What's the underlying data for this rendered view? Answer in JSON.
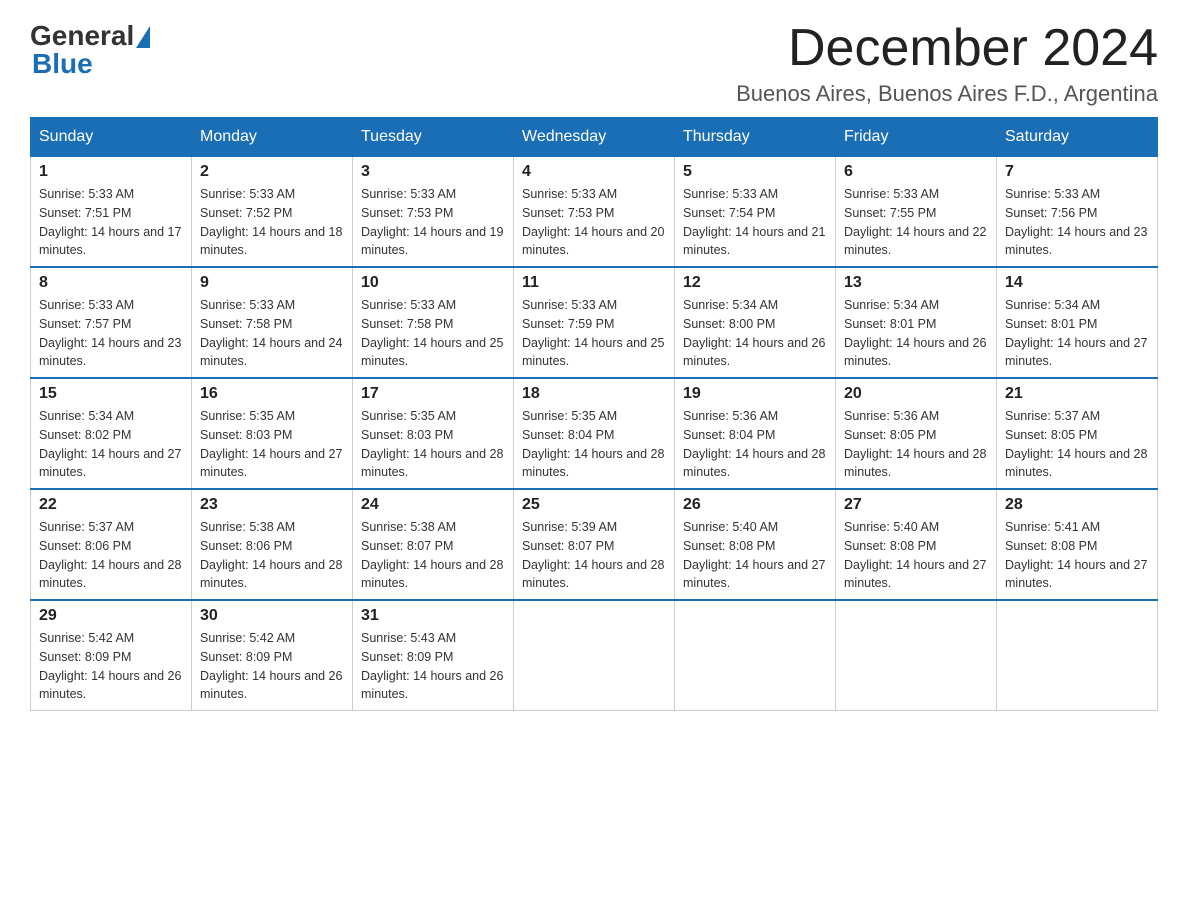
{
  "header": {
    "logo_general": "General",
    "logo_blue": "Blue",
    "month_title": "December 2024",
    "location": "Buenos Aires, Buenos Aires F.D., Argentina"
  },
  "weekdays": [
    "Sunday",
    "Monday",
    "Tuesday",
    "Wednesday",
    "Thursday",
    "Friday",
    "Saturday"
  ],
  "weeks": [
    [
      {
        "day": "1",
        "sunrise": "5:33 AM",
        "sunset": "7:51 PM",
        "daylight": "14 hours and 17 minutes."
      },
      {
        "day": "2",
        "sunrise": "5:33 AM",
        "sunset": "7:52 PM",
        "daylight": "14 hours and 18 minutes."
      },
      {
        "day": "3",
        "sunrise": "5:33 AM",
        "sunset": "7:53 PM",
        "daylight": "14 hours and 19 minutes."
      },
      {
        "day": "4",
        "sunrise": "5:33 AM",
        "sunset": "7:53 PM",
        "daylight": "14 hours and 20 minutes."
      },
      {
        "day": "5",
        "sunrise": "5:33 AM",
        "sunset": "7:54 PM",
        "daylight": "14 hours and 21 minutes."
      },
      {
        "day": "6",
        "sunrise": "5:33 AM",
        "sunset": "7:55 PM",
        "daylight": "14 hours and 22 minutes."
      },
      {
        "day": "7",
        "sunrise": "5:33 AM",
        "sunset": "7:56 PM",
        "daylight": "14 hours and 23 minutes."
      }
    ],
    [
      {
        "day": "8",
        "sunrise": "5:33 AM",
        "sunset": "7:57 PM",
        "daylight": "14 hours and 23 minutes."
      },
      {
        "day": "9",
        "sunrise": "5:33 AM",
        "sunset": "7:58 PM",
        "daylight": "14 hours and 24 minutes."
      },
      {
        "day": "10",
        "sunrise": "5:33 AM",
        "sunset": "7:58 PM",
        "daylight": "14 hours and 25 minutes."
      },
      {
        "day": "11",
        "sunrise": "5:33 AM",
        "sunset": "7:59 PM",
        "daylight": "14 hours and 25 minutes."
      },
      {
        "day": "12",
        "sunrise": "5:34 AM",
        "sunset": "8:00 PM",
        "daylight": "14 hours and 26 minutes."
      },
      {
        "day": "13",
        "sunrise": "5:34 AM",
        "sunset": "8:01 PM",
        "daylight": "14 hours and 26 minutes."
      },
      {
        "day": "14",
        "sunrise": "5:34 AM",
        "sunset": "8:01 PM",
        "daylight": "14 hours and 27 minutes."
      }
    ],
    [
      {
        "day": "15",
        "sunrise": "5:34 AM",
        "sunset": "8:02 PM",
        "daylight": "14 hours and 27 minutes."
      },
      {
        "day": "16",
        "sunrise": "5:35 AM",
        "sunset": "8:03 PM",
        "daylight": "14 hours and 27 minutes."
      },
      {
        "day": "17",
        "sunrise": "5:35 AM",
        "sunset": "8:03 PM",
        "daylight": "14 hours and 28 minutes."
      },
      {
        "day": "18",
        "sunrise": "5:35 AM",
        "sunset": "8:04 PM",
        "daylight": "14 hours and 28 minutes."
      },
      {
        "day": "19",
        "sunrise": "5:36 AM",
        "sunset": "8:04 PM",
        "daylight": "14 hours and 28 minutes."
      },
      {
        "day": "20",
        "sunrise": "5:36 AM",
        "sunset": "8:05 PM",
        "daylight": "14 hours and 28 minutes."
      },
      {
        "day": "21",
        "sunrise": "5:37 AM",
        "sunset": "8:05 PM",
        "daylight": "14 hours and 28 minutes."
      }
    ],
    [
      {
        "day": "22",
        "sunrise": "5:37 AM",
        "sunset": "8:06 PM",
        "daylight": "14 hours and 28 minutes."
      },
      {
        "day": "23",
        "sunrise": "5:38 AM",
        "sunset": "8:06 PM",
        "daylight": "14 hours and 28 minutes."
      },
      {
        "day": "24",
        "sunrise": "5:38 AM",
        "sunset": "8:07 PM",
        "daylight": "14 hours and 28 minutes."
      },
      {
        "day": "25",
        "sunrise": "5:39 AM",
        "sunset": "8:07 PM",
        "daylight": "14 hours and 28 minutes."
      },
      {
        "day": "26",
        "sunrise": "5:40 AM",
        "sunset": "8:08 PM",
        "daylight": "14 hours and 27 minutes."
      },
      {
        "day": "27",
        "sunrise": "5:40 AM",
        "sunset": "8:08 PM",
        "daylight": "14 hours and 27 minutes."
      },
      {
        "day": "28",
        "sunrise": "5:41 AM",
        "sunset": "8:08 PM",
        "daylight": "14 hours and 27 minutes."
      }
    ],
    [
      {
        "day": "29",
        "sunrise": "5:42 AM",
        "sunset": "8:09 PM",
        "daylight": "14 hours and 26 minutes."
      },
      {
        "day": "30",
        "sunrise": "5:42 AM",
        "sunset": "8:09 PM",
        "daylight": "14 hours and 26 minutes."
      },
      {
        "day": "31",
        "sunrise": "5:43 AM",
        "sunset": "8:09 PM",
        "daylight": "14 hours and 26 minutes."
      },
      null,
      null,
      null,
      null
    ]
  ]
}
